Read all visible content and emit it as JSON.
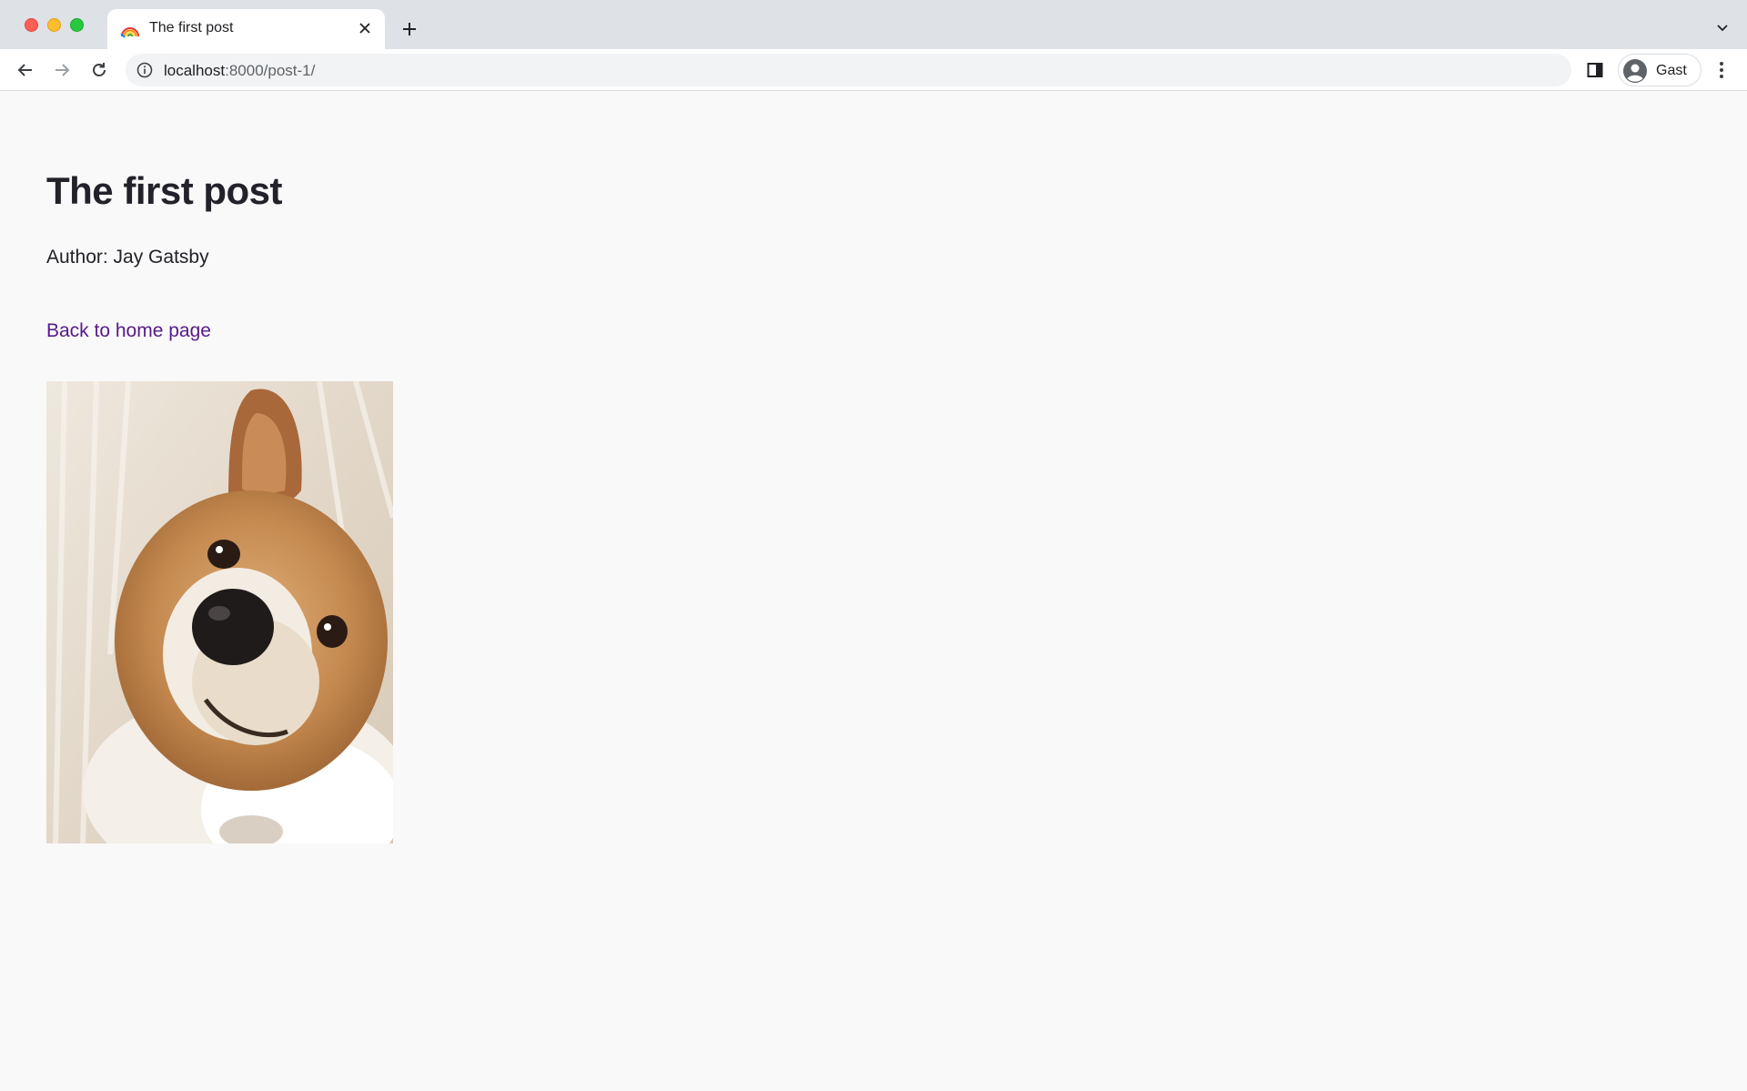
{
  "browser": {
    "tab": {
      "title": "The first post",
      "favicon": "rainbow-icon"
    },
    "address_bar": {
      "host": "localhost",
      "path": ":8000/post-1/"
    },
    "profile": {
      "name": "Gast"
    },
    "icons": {
      "back": "arrow-left-icon",
      "forward": "arrow-right-icon",
      "reload": "reload-icon",
      "site_info": "info-icon",
      "side_panel": "side-panel-icon",
      "menu": "kebab-icon",
      "new_tab": "plus-icon",
      "tab_search": "chevron-down-icon",
      "close_tab": "close-icon"
    }
  },
  "post": {
    "title": "The first post",
    "author": "Author: Jay Gatsby",
    "back_link": "Back to home page",
    "image_subject": "dog-photo"
  },
  "colors": {
    "link": "#551a8b",
    "text": "#232129",
    "page_bg": "#f9f9f9"
  }
}
